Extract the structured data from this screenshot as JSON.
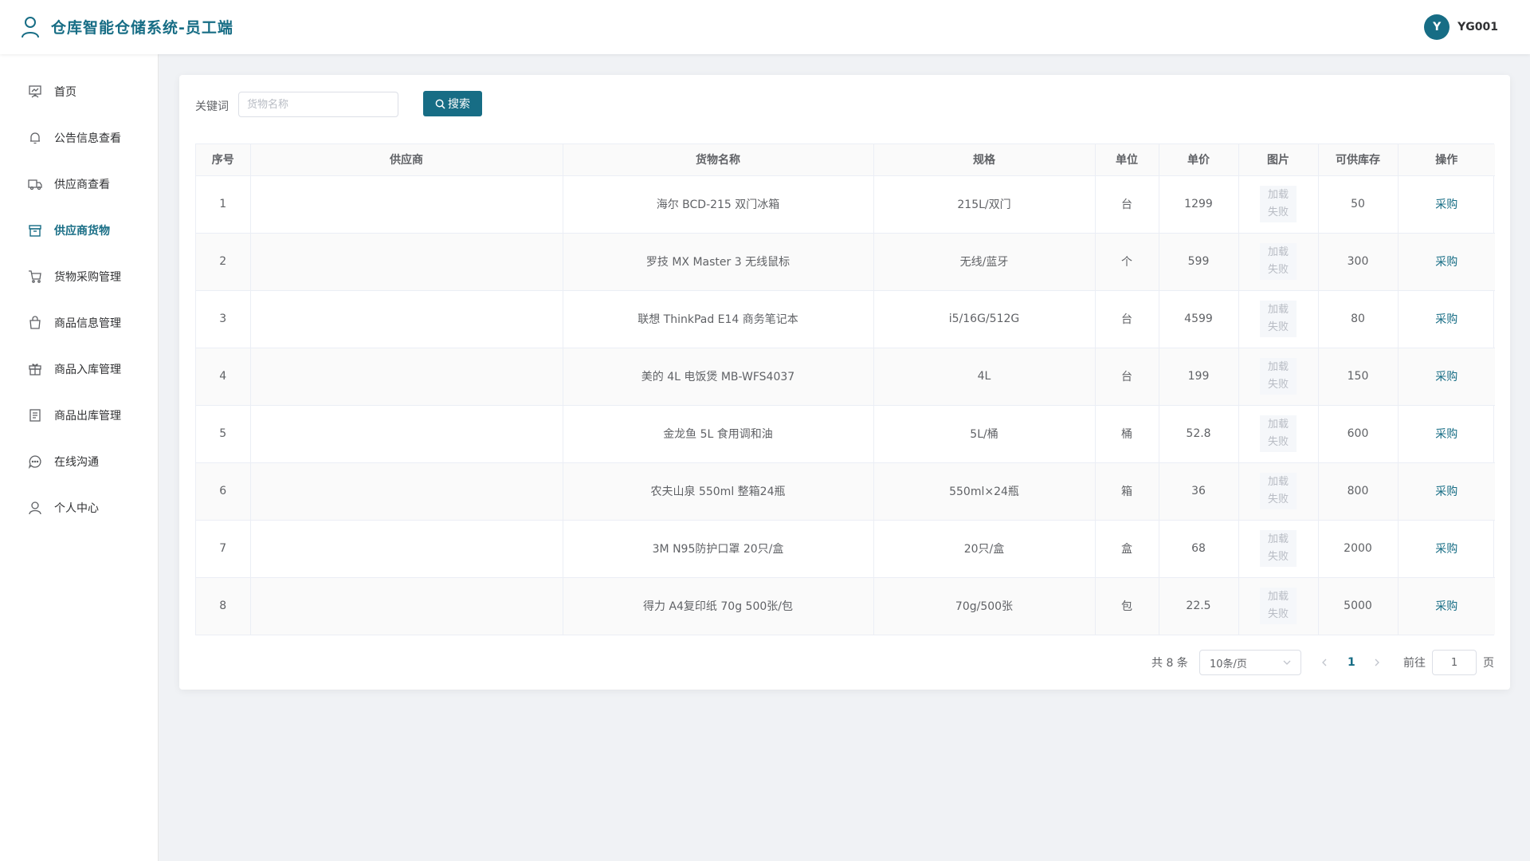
{
  "header": {
    "title": "仓库智能仓储系统-员工端",
    "avatar_letter": "Y",
    "username": "YG001"
  },
  "sidebar": {
    "items": [
      {
        "label": "首页",
        "icon": "presentation-icon"
      },
      {
        "label": "公告信息查看",
        "icon": "bell-icon"
      },
      {
        "label": "供应商查看",
        "icon": "truck-icon"
      },
      {
        "label": "供应商货物",
        "icon": "box-icon",
        "active": true
      },
      {
        "label": "货物采购管理",
        "icon": "cart-icon"
      },
      {
        "label": "商品信息管理",
        "icon": "bag-icon"
      },
      {
        "label": "商品入库管理",
        "icon": "gift-box-icon"
      },
      {
        "label": "商品出库管理",
        "icon": "document-icon"
      },
      {
        "label": "在线沟通",
        "icon": "chat-icon"
      },
      {
        "label": "个人中心",
        "icon": "user-icon"
      }
    ]
  },
  "search": {
    "label": "关键词",
    "placeholder": "货物名称",
    "button_label": "搜索"
  },
  "table": {
    "columns": [
      "序号",
      "供应商",
      "货物名称",
      "规格",
      "单位",
      "单价",
      "图片",
      "可供库存",
      "操作"
    ],
    "image_placeholder": "加载失败",
    "action_label": "采购",
    "rows": [
      {
        "no": "1",
        "supplier": "",
        "name": "海尔 BCD-215 双门冰箱",
        "spec": "215L/双门",
        "unit": "台",
        "price": "1299",
        "stock": "50"
      },
      {
        "no": "2",
        "supplier": "",
        "name": "罗技 MX Master 3 无线鼠标",
        "spec": "无线/蓝牙",
        "unit": "个",
        "price": "599",
        "stock": "300"
      },
      {
        "no": "3",
        "supplier": "",
        "name": "联想 ThinkPad E14 商务笔记本",
        "spec": "i5/16G/512G",
        "unit": "台",
        "price": "4599",
        "stock": "80"
      },
      {
        "no": "4",
        "supplier": "",
        "name": "美的 4L 电饭煲 MB-WFS4037",
        "spec": "4L",
        "unit": "台",
        "price": "199",
        "stock": "150"
      },
      {
        "no": "5",
        "supplier": "",
        "name": "金龙鱼 5L 食用调和油",
        "spec": "5L/桶",
        "unit": "桶",
        "price": "52.8",
        "stock": "600"
      },
      {
        "no": "6",
        "supplier": "",
        "name": "农夫山泉 550ml 整箱24瓶",
        "spec": "550ml×24瓶",
        "unit": "箱",
        "price": "36",
        "stock": "800"
      },
      {
        "no": "7",
        "supplier": "",
        "name": "3M N95防护口罩 20只/盒",
        "spec": "20只/盒",
        "unit": "盒",
        "price": "68",
        "stock": "2000"
      },
      {
        "no": "8",
        "supplier": "",
        "name": "得力 A4复印纸 70g 500张/包",
        "spec": "70g/500张",
        "unit": "包",
        "price": "22.5",
        "stock": "5000"
      }
    ]
  },
  "pagination": {
    "total_text": "共 8 条",
    "page_size": "10条/页",
    "current_page": "1",
    "goto_label": "前往",
    "goto_value": "1",
    "page_unit": "页"
  },
  "colors": {
    "primary": "#176d85"
  }
}
